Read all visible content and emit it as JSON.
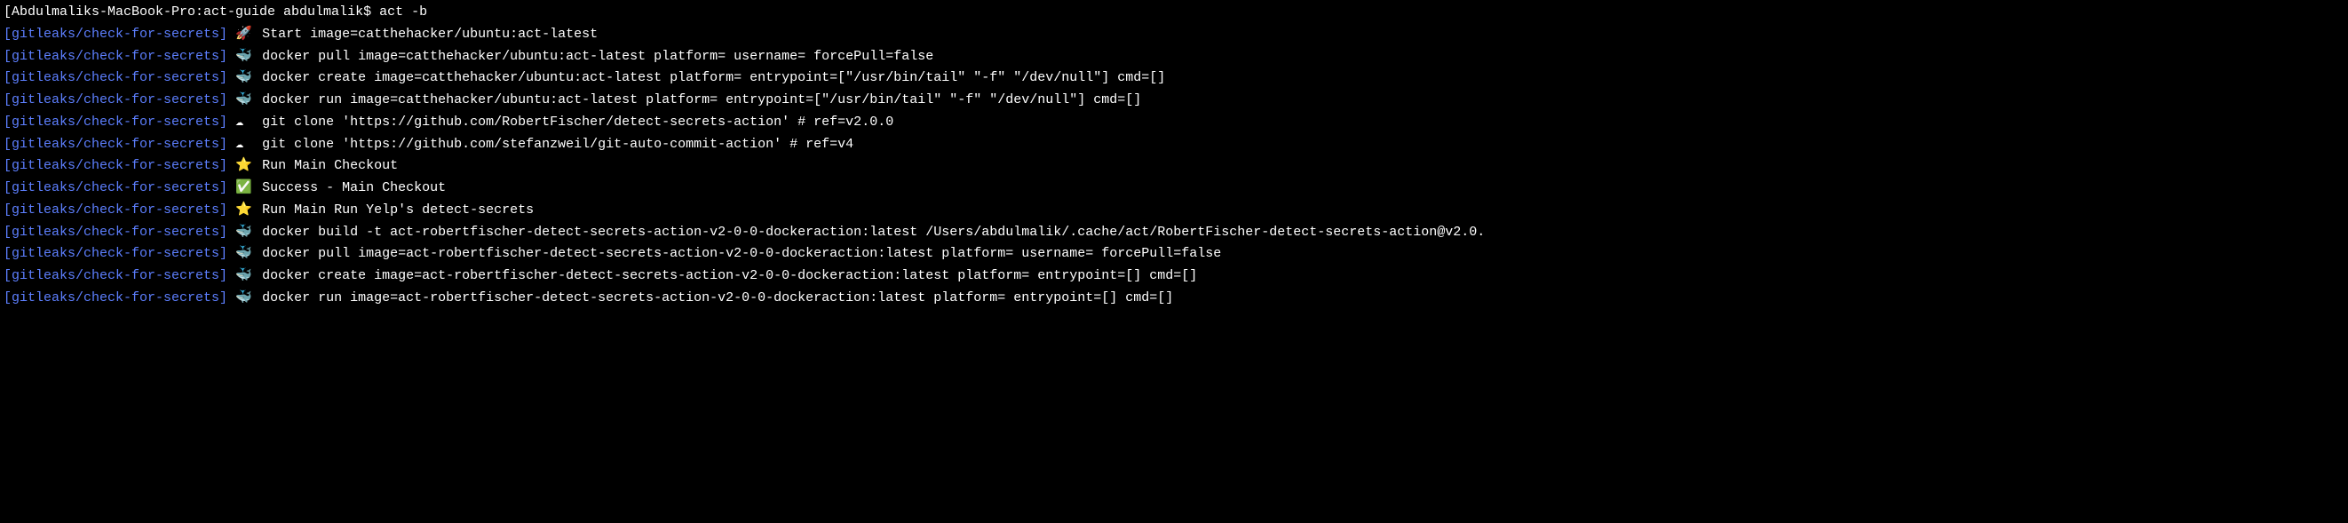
{
  "prompt": {
    "host": "Abdulmaliks-MacBook-Pro",
    "dir": "act-guide",
    "user": "abdulmalik",
    "command": "act -b"
  },
  "prefix": "[gitleaks/check-for-secrets]",
  "lines": [
    {
      "icon": "🚀",
      "text": "Start image=catthehacker/ubuntu:act-latest",
      "indent": 1
    },
    {
      "icon": "🐳",
      "text": "docker pull image=catthehacker/ubuntu:act-latest platform= username= forcePull=false",
      "indent": 2
    },
    {
      "icon": "🐳",
      "text": "docker create image=catthehacker/ubuntu:act-latest platform= entrypoint=[\"/usr/bin/tail\" \"-f\" \"/dev/null\"] cmd=[]",
      "indent": 2
    },
    {
      "icon": "🐳",
      "text": "docker run image=catthehacker/ubuntu:act-latest platform= entrypoint=[\"/usr/bin/tail\" \"-f\" \"/dev/null\"] cmd=[]",
      "indent": 2
    },
    {
      "icon": "☁",
      "text": "git clone 'https://github.com/RobertFischer/detect-secrets-action' # ref=v2.0.0",
      "indent": 2
    },
    {
      "icon": "☁",
      "text": "git clone 'https://github.com/stefanzweil/git-auto-commit-action' # ref=v4",
      "indent": 2
    },
    {
      "icon": "⭐",
      "text": "Run Main Checkout",
      "indent": 1
    },
    {
      "icon": "✅",
      "text": "Success - Main Checkout",
      "indent": 2
    },
    {
      "icon": "⭐",
      "text": "Run Main Run Yelp's detect-secrets",
      "indent": 1
    },
    {
      "icon": "🐳",
      "text": "docker build -t act-robertfischer-detect-secrets-action-v2-0-0-dockeraction:latest /Users/abdulmalik/.cache/act/RobertFischer-detect-secrets-action@v2.0.",
      "indent": 2
    },
    {
      "icon": "🐳",
      "text": "docker pull image=act-robertfischer-detect-secrets-action-v2-0-0-dockeraction:latest platform= username= forcePull=false",
      "indent": 2
    },
    {
      "icon": "🐳",
      "text": "docker create image=act-robertfischer-detect-secrets-action-v2-0-0-dockeraction:latest platform= entrypoint=[] cmd=[]",
      "indent": 2
    },
    {
      "icon": "🐳",
      "text": "docker run image=act-robertfischer-detect-secrets-action-v2-0-0-dockeraction:latest platform= entrypoint=[] cmd=[]",
      "indent": 2
    }
  ]
}
